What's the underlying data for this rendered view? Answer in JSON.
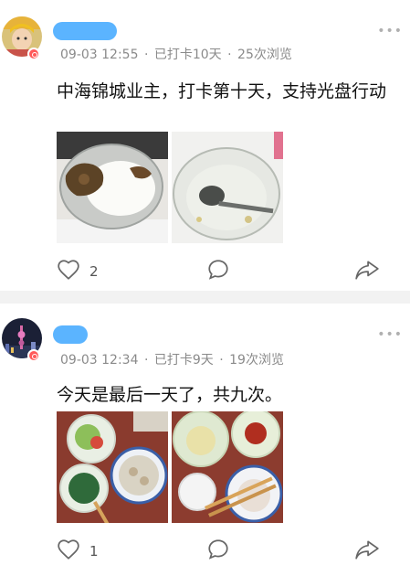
{
  "posts": [
    {
      "date": "09-03 12:55",
      "checkin": "已打卡10天",
      "views": "25次浏览",
      "separator": "·",
      "text": "中海锦城业主，打卡第十天，支持光盘行动",
      "likes": "2",
      "photos": [
        "rice-with-meat-photo",
        "empty-bowl-with-spoon-photo"
      ]
    },
    {
      "date": "09-03 12:34",
      "checkin": "已打卡9天",
      "views": "19次浏览",
      "separator": "·",
      "text": "今天是最后一天了，共九次。",
      "likes": "1",
      "photos": [
        "lunch-tray-photo",
        "empty-bowls-photo"
      ]
    }
  ],
  "icons": {
    "like": "heart-outline-icon",
    "comment": "speech-bubble-icon",
    "share": "share-arrow-icon",
    "more": "ellipsis-icon"
  },
  "colors": {
    "name_mask": "#5bb4ff",
    "badge": "#ff5a5a",
    "meta_text": "#8a8a8a",
    "separator_band": "#f2f2f2"
  }
}
